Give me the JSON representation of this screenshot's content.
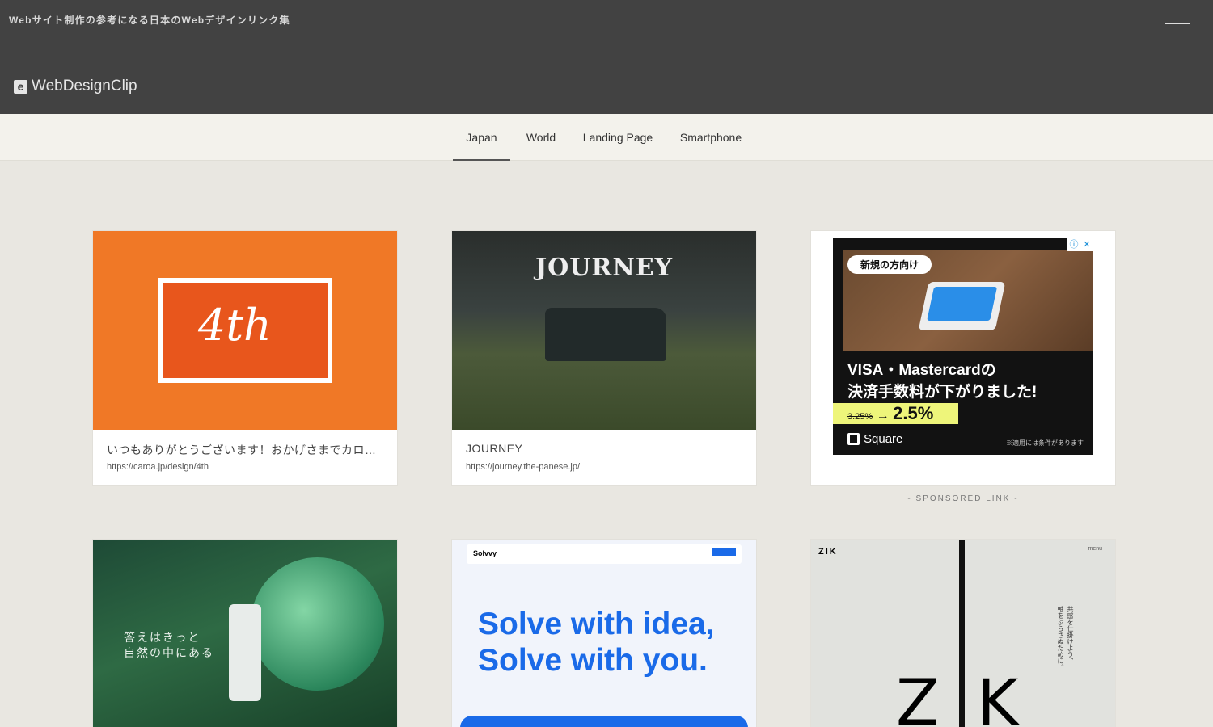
{
  "header": {
    "tagline": "Webサイト制作の参考になる日本のWebデザインリンク集",
    "logo": "WebDesignClip",
    "logo_mark": "e",
    "menu_icon": "hamburger-icon"
  },
  "nav": {
    "tabs": [
      {
        "label": "Japan",
        "active": true
      },
      {
        "label": "World"
      },
      {
        "label": "Landing Page"
      },
      {
        "label": "Smartphone"
      }
    ]
  },
  "cards": [
    {
      "title": "いつもありがとうございます！おかげさまでカロ…",
      "url": "https://caroa.jp/design/4th",
      "thumb_text": "4th"
    },
    {
      "title": "JOURNEY",
      "url": "https://journey.the-panese.jp/",
      "thumb_text": "JOURNEY"
    },
    {
      "thumb_text": "答えはきっと\n自然の中にある"
    },
    {
      "thumb_brand": "Solvvy",
      "thumb_text": "Solve with idea,\nSolve with you."
    },
    {
      "thumb_brand": "ZIK",
      "thumb_menu": "menu",
      "thumb_text": "Z",
      "thumb_text2": "K",
      "thumb_vertical": "共感を仕掛けよう、\n軸をぶらさぬために。"
    }
  ],
  "ad": {
    "pill": "新規の方向け",
    "line1": "VISA・Mastercardの",
    "line2": "決済手数料が下がりました!",
    "old_rate": "3.25%",
    "arrow": "→",
    "new_rate": "2.5%",
    "brand": "Square",
    "note": "※適用には条件があります",
    "info": "ⓘ",
    "close": "✕",
    "highlight_color": "#eef57a"
  },
  "sponsored": "- SPONSORED LINK -"
}
